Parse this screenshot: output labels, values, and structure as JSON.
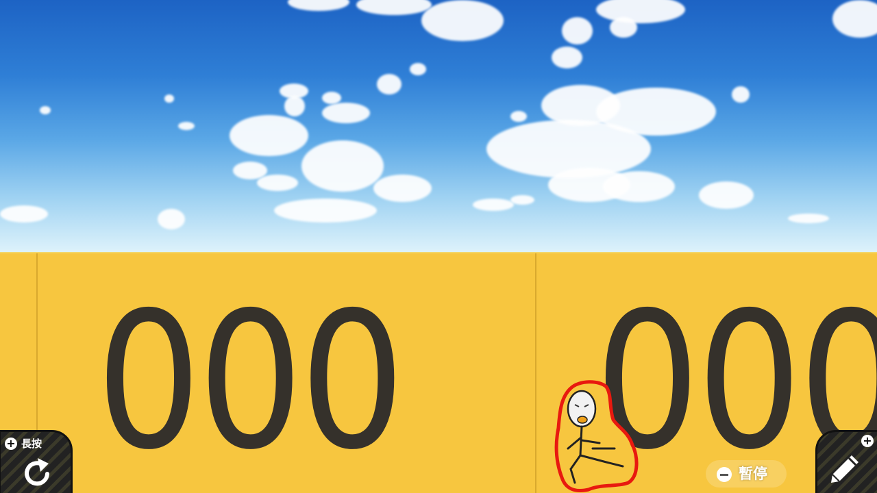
{
  "hud": {
    "reset_button": {
      "hint": "長按",
      "plus_glyph": "+",
      "icon": "rotate-arrow-icon"
    },
    "draw_button": {
      "plus_glyph": "+",
      "icon": "pencil-icon"
    },
    "pause_button": {
      "label": "暫停",
      "icon": "minus-circle-icon"
    }
  },
  "scene": {
    "wall_number_left": "000",
    "wall_number_right": "000",
    "colors": {
      "sky_top": "#1d63c4",
      "wall": "#f7c63f",
      "digits": "#35312b",
      "player_outline": "#e8190f"
    }
  }
}
